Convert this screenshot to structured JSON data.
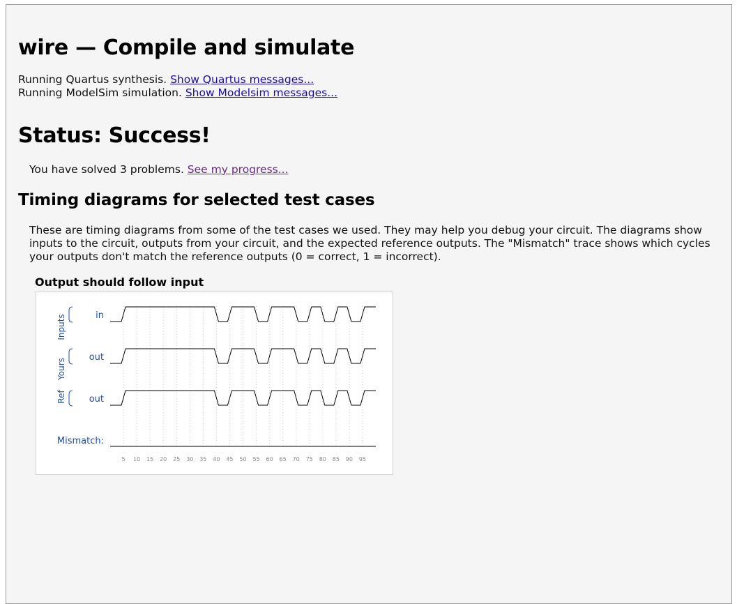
{
  "page": {
    "title": "wire — Compile and simulate",
    "status_heading": "Status: Success!",
    "timing_heading": "Timing diagrams for selected test cases"
  },
  "runs": [
    {
      "text": "Running Quartus synthesis. ",
      "link": "Show Quartus messages..."
    },
    {
      "text": "Running ModelSim simulation. ",
      "link": "Show Modelsim messages..."
    }
  ],
  "solved": {
    "text": "You have solved 3 problems. ",
    "link": "See my progress..."
  },
  "description": "These are timing diagrams from some of the test cases we used. They may help you debug your circuit. The diagrams show inputs to the circuit, outputs from your circuit, and the expected reference outputs. The \"Mismatch\" trace shows which cycles your outputs don't match the reference outputs (0 = correct, 1 = incorrect).",
  "diagram": {
    "title": "Output should follow input",
    "groups": [
      {
        "label": "Inputs",
        "signals": [
          {
            "name": "in",
            "trace": "in"
          }
        ]
      },
      {
        "label": "Yours",
        "signals": [
          {
            "name": "out",
            "trace": "yours_out"
          }
        ]
      },
      {
        "label": "Ref",
        "signals": [
          {
            "name": "out",
            "trace": "ref_out"
          }
        ]
      }
    ],
    "mismatch_label": "Mismatch:",
    "colors": {
      "label": "#1a4fb3",
      "trace": "#000000",
      "grid": "#c8c8c8",
      "tick": "#888888"
    },
    "time_range": [
      0,
      100
    ],
    "ticks": [
      5,
      10,
      15,
      20,
      25,
      30,
      35,
      40,
      45,
      50,
      55,
      60,
      65,
      70,
      75,
      80,
      85,
      90,
      95
    ],
    "traces": {
      "in": [
        [
          0,
          0
        ],
        [
          5,
          1
        ],
        [
          35,
          1
        ],
        [
          40,
          0
        ],
        [
          45,
          1
        ],
        [
          50,
          1
        ],
        [
          55,
          0
        ],
        [
          60,
          1
        ],
        [
          65,
          1
        ],
        [
          70,
          0
        ],
        [
          75,
          1
        ],
        [
          80,
          0
        ],
        [
          85,
          1
        ],
        [
          90,
          0
        ],
        [
          95,
          1
        ]
      ],
      "yours_out": [
        [
          0,
          0
        ],
        [
          5,
          1
        ],
        [
          35,
          1
        ],
        [
          40,
          0
        ],
        [
          45,
          1
        ],
        [
          50,
          1
        ],
        [
          55,
          0
        ],
        [
          60,
          1
        ],
        [
          65,
          1
        ],
        [
          70,
          0
        ],
        [
          75,
          1
        ],
        [
          80,
          0
        ],
        [
          85,
          1
        ],
        [
          90,
          0
        ],
        [
          95,
          1
        ]
      ],
      "ref_out": [
        [
          0,
          0
        ],
        [
          5,
          1
        ],
        [
          35,
          1
        ],
        [
          40,
          0
        ],
        [
          45,
          1
        ],
        [
          50,
          1
        ],
        [
          55,
          0
        ],
        [
          60,
          1
        ],
        [
          65,
          1
        ],
        [
          70,
          0
        ],
        [
          75,
          1
        ],
        [
          80,
          0
        ],
        [
          85,
          1
        ],
        [
          90,
          0
        ],
        [
          95,
          1
        ]
      ],
      "mismatch": [
        [
          0,
          0
        ]
      ]
    }
  }
}
